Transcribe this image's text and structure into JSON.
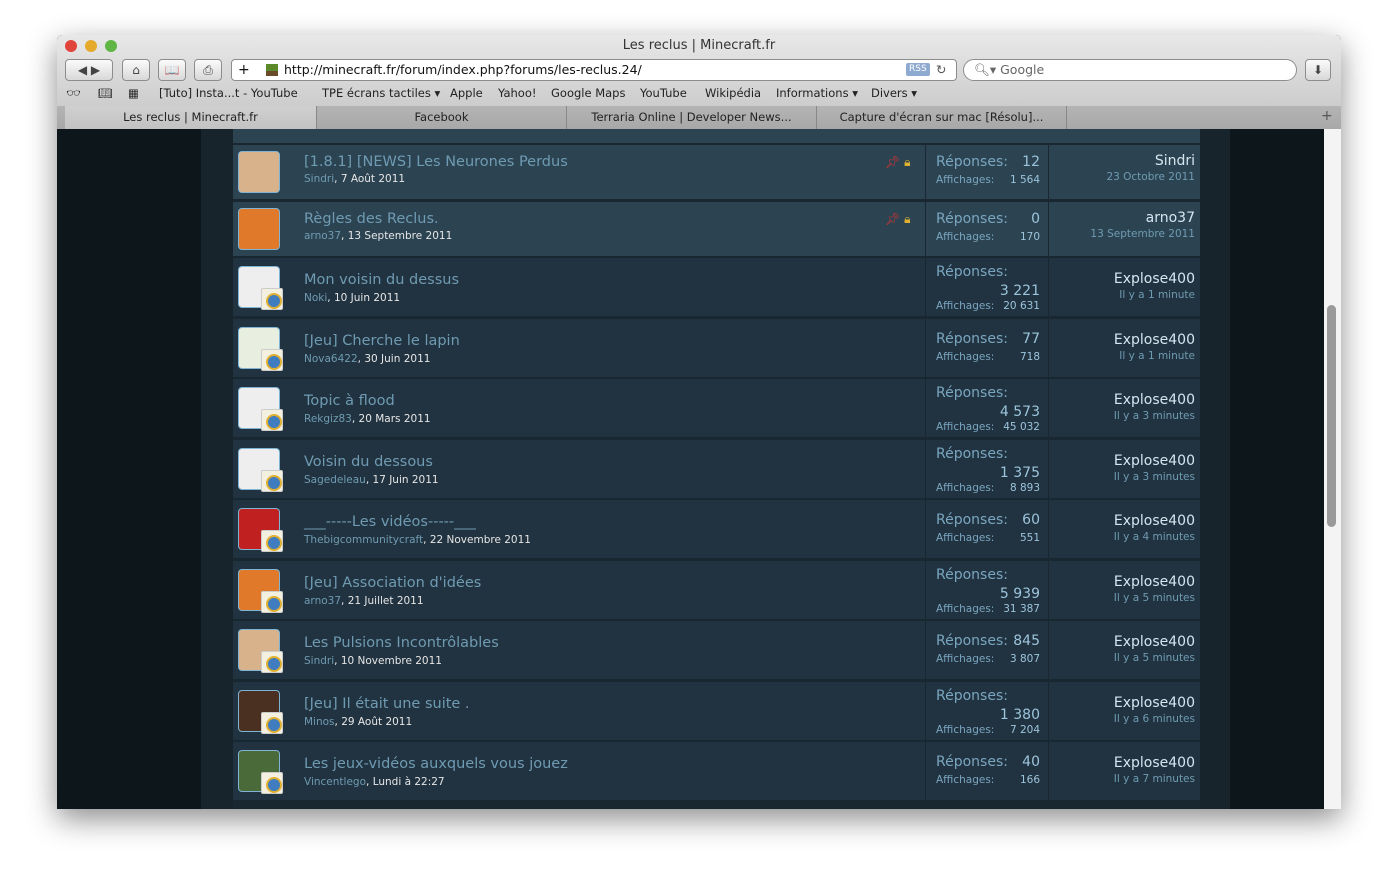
{
  "window": {
    "title": "Les reclus | Minecraft.fr"
  },
  "toolbar": {
    "url": "http://minecraft.fr/forum/index.php?forums/les-reclus.24/",
    "rss": "RSS",
    "search_placeholder": "Google"
  },
  "bookmarks": [
    "[Tuto] Insta...t - YouTube",
    "TPE écrans tactiles ▾",
    "Apple",
    "Yahoo!",
    "Google Maps",
    "YouTube",
    "Wikipédia",
    "Informations ▾",
    "Divers ▾"
  ],
  "tabs": [
    {
      "label": "Les reclus | Minecraft.fr",
      "active": true
    },
    {
      "label": "Facebook"
    },
    {
      "label": "Terraria Online | Developer News..."
    },
    {
      "label": "Capture d'écran sur mac [Résolu]..."
    }
  ],
  "labels": {
    "replies": "Réponses:",
    "views": "Affichages:"
  },
  "threads": [
    {
      "title": "[1.8.1] [NEWS] Les Neurones Perdus",
      "author": "Sindri",
      "date": "7 Août 2011",
      "replies": "12",
      "views": "1 564",
      "last_user": "Sindri",
      "last_time": "23 Octobre 2011",
      "sticky": true,
      "locked": true,
      "avatar": "mustache"
    },
    {
      "title": "Règles des Reclus.",
      "author": "arno37",
      "date": "13 Septembre 2011",
      "replies": "0",
      "views": "170",
      "last_user": "arno37",
      "last_time": "13 Septembre 2011",
      "sticky": true,
      "locked": true,
      "avatar": "fox"
    },
    {
      "title": "Mon voisin du dessus",
      "author": "Noki",
      "date": "10 Juin 2011",
      "replies": "3 221",
      "views": "20 631",
      "last_user": "Explose400",
      "last_time": "Il y a 1 minute",
      "avatar": "blank"
    },
    {
      "title": "[Jeu] Cherche le lapin",
      "author": "Nova6422",
      "date": "30 Juin 2011",
      "replies": "77",
      "views": "718",
      "last_user": "Explose400",
      "last_time": "Il y a 1 minute",
      "avatar": "ghost"
    },
    {
      "title": "Topic à flood",
      "author": "Rekgiz83",
      "date": "20 Mars 2011",
      "replies": "4 573",
      "views": "45 032",
      "last_user": "Explose400",
      "last_time": "Il y a 3 minutes",
      "avatar": "blank"
    },
    {
      "title": "Voisin du dessous",
      "author": "Sagedeleau",
      "date": "17 Juin 2011",
      "replies": "1 375",
      "views": "8 893",
      "last_user": "Explose400",
      "last_time": "Il y a 3 minutes",
      "avatar": "blank"
    },
    {
      "title": "___-----Les vidéos-----___",
      "author": "Thebigcommunitycraft",
      "date": "22 Novembre 2011",
      "replies": "60",
      "views": "551",
      "last_user": "Explose400",
      "last_time": "Il y a 4 minutes",
      "avatar": "meatboy"
    },
    {
      "title": "[Jeu] Association d'idées",
      "author": "arno37",
      "date": "21 Juillet 2011",
      "replies": "5 939",
      "views": "31 387",
      "last_user": "Explose400",
      "last_time": "Il y a 5 minutes",
      "avatar": "fox"
    },
    {
      "title": "Les Pulsions Incontrôlables",
      "author": "Sindri",
      "date": "10 Novembre 2011",
      "replies": "845",
      "views": "3 807",
      "last_user": "Explose400",
      "last_time": "Il y a 5 minutes",
      "avatar": "mustache"
    },
    {
      "title": "[Jeu] Il était une suite .",
      "author": "Minos",
      "date": "29 Août 2011",
      "replies": "1 380",
      "views": "7 204",
      "last_user": "Explose400",
      "last_time": "Il y a 6 minutes",
      "avatar": "dark"
    },
    {
      "title": "Les jeux-vidéos auxquels vous jouez",
      "author": "Vincentlego",
      "date": "Lundi à 22:27",
      "replies": "40",
      "views": "166",
      "last_user": "Explose400",
      "last_time": "Il y a 7 minutes",
      "avatar": "creeper"
    }
  ],
  "colors": {
    "link": "#6f9bb2",
    "sticky_row": "#2c4452",
    "row": "#213340"
  }
}
